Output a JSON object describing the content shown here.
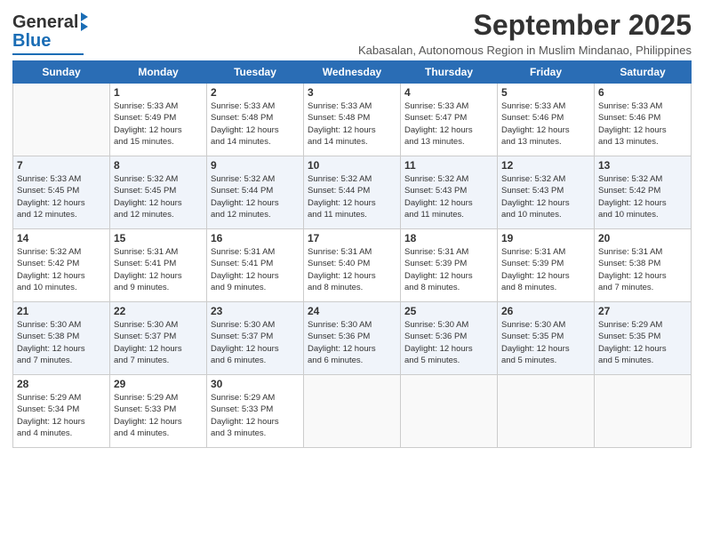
{
  "logo": {
    "text1": "General",
    "text2": "Blue"
  },
  "title": "September 2025",
  "subtitle": "Kabasalan, Autonomous Region in Muslim Mindanao, Philippines",
  "headers": [
    "Sunday",
    "Monday",
    "Tuesday",
    "Wednesday",
    "Thursday",
    "Friday",
    "Saturday"
  ],
  "weeks": [
    [
      {
        "day": "",
        "info": ""
      },
      {
        "day": "1",
        "info": "Sunrise: 5:33 AM\nSunset: 5:49 PM\nDaylight: 12 hours\nand 15 minutes."
      },
      {
        "day": "2",
        "info": "Sunrise: 5:33 AM\nSunset: 5:48 PM\nDaylight: 12 hours\nand 14 minutes."
      },
      {
        "day": "3",
        "info": "Sunrise: 5:33 AM\nSunset: 5:48 PM\nDaylight: 12 hours\nand 14 minutes."
      },
      {
        "day": "4",
        "info": "Sunrise: 5:33 AM\nSunset: 5:47 PM\nDaylight: 12 hours\nand 13 minutes."
      },
      {
        "day": "5",
        "info": "Sunrise: 5:33 AM\nSunset: 5:46 PM\nDaylight: 12 hours\nand 13 minutes."
      },
      {
        "day": "6",
        "info": "Sunrise: 5:33 AM\nSunset: 5:46 PM\nDaylight: 12 hours\nand 13 minutes."
      }
    ],
    [
      {
        "day": "7",
        "info": "Sunrise: 5:33 AM\nSunset: 5:45 PM\nDaylight: 12 hours\nand 12 minutes."
      },
      {
        "day": "8",
        "info": "Sunrise: 5:32 AM\nSunset: 5:45 PM\nDaylight: 12 hours\nand 12 minutes."
      },
      {
        "day": "9",
        "info": "Sunrise: 5:32 AM\nSunset: 5:44 PM\nDaylight: 12 hours\nand 12 minutes."
      },
      {
        "day": "10",
        "info": "Sunrise: 5:32 AM\nSunset: 5:44 PM\nDaylight: 12 hours\nand 11 minutes."
      },
      {
        "day": "11",
        "info": "Sunrise: 5:32 AM\nSunset: 5:43 PM\nDaylight: 12 hours\nand 11 minutes."
      },
      {
        "day": "12",
        "info": "Sunrise: 5:32 AM\nSunset: 5:43 PM\nDaylight: 12 hours\nand 10 minutes."
      },
      {
        "day": "13",
        "info": "Sunrise: 5:32 AM\nSunset: 5:42 PM\nDaylight: 12 hours\nand 10 minutes."
      }
    ],
    [
      {
        "day": "14",
        "info": "Sunrise: 5:32 AM\nSunset: 5:42 PM\nDaylight: 12 hours\nand 10 minutes."
      },
      {
        "day": "15",
        "info": "Sunrise: 5:31 AM\nSunset: 5:41 PM\nDaylight: 12 hours\nand 9 minutes."
      },
      {
        "day": "16",
        "info": "Sunrise: 5:31 AM\nSunset: 5:41 PM\nDaylight: 12 hours\nand 9 minutes."
      },
      {
        "day": "17",
        "info": "Sunrise: 5:31 AM\nSunset: 5:40 PM\nDaylight: 12 hours\nand 8 minutes."
      },
      {
        "day": "18",
        "info": "Sunrise: 5:31 AM\nSunset: 5:39 PM\nDaylight: 12 hours\nand 8 minutes."
      },
      {
        "day": "19",
        "info": "Sunrise: 5:31 AM\nSunset: 5:39 PM\nDaylight: 12 hours\nand 8 minutes."
      },
      {
        "day": "20",
        "info": "Sunrise: 5:31 AM\nSunset: 5:38 PM\nDaylight: 12 hours\nand 7 minutes."
      }
    ],
    [
      {
        "day": "21",
        "info": "Sunrise: 5:30 AM\nSunset: 5:38 PM\nDaylight: 12 hours\nand 7 minutes."
      },
      {
        "day": "22",
        "info": "Sunrise: 5:30 AM\nSunset: 5:37 PM\nDaylight: 12 hours\nand 7 minutes."
      },
      {
        "day": "23",
        "info": "Sunrise: 5:30 AM\nSunset: 5:37 PM\nDaylight: 12 hours\nand 6 minutes."
      },
      {
        "day": "24",
        "info": "Sunrise: 5:30 AM\nSunset: 5:36 PM\nDaylight: 12 hours\nand 6 minutes."
      },
      {
        "day": "25",
        "info": "Sunrise: 5:30 AM\nSunset: 5:36 PM\nDaylight: 12 hours\nand 5 minutes."
      },
      {
        "day": "26",
        "info": "Sunrise: 5:30 AM\nSunset: 5:35 PM\nDaylight: 12 hours\nand 5 minutes."
      },
      {
        "day": "27",
        "info": "Sunrise: 5:29 AM\nSunset: 5:35 PM\nDaylight: 12 hours\nand 5 minutes."
      }
    ],
    [
      {
        "day": "28",
        "info": "Sunrise: 5:29 AM\nSunset: 5:34 PM\nDaylight: 12 hours\nand 4 minutes."
      },
      {
        "day": "29",
        "info": "Sunrise: 5:29 AM\nSunset: 5:33 PM\nDaylight: 12 hours\nand 4 minutes."
      },
      {
        "day": "30",
        "info": "Sunrise: 5:29 AM\nSunset: 5:33 PM\nDaylight: 12 hours\nand 3 minutes."
      },
      {
        "day": "",
        "info": ""
      },
      {
        "day": "",
        "info": ""
      },
      {
        "day": "",
        "info": ""
      },
      {
        "day": "",
        "info": ""
      }
    ]
  ]
}
